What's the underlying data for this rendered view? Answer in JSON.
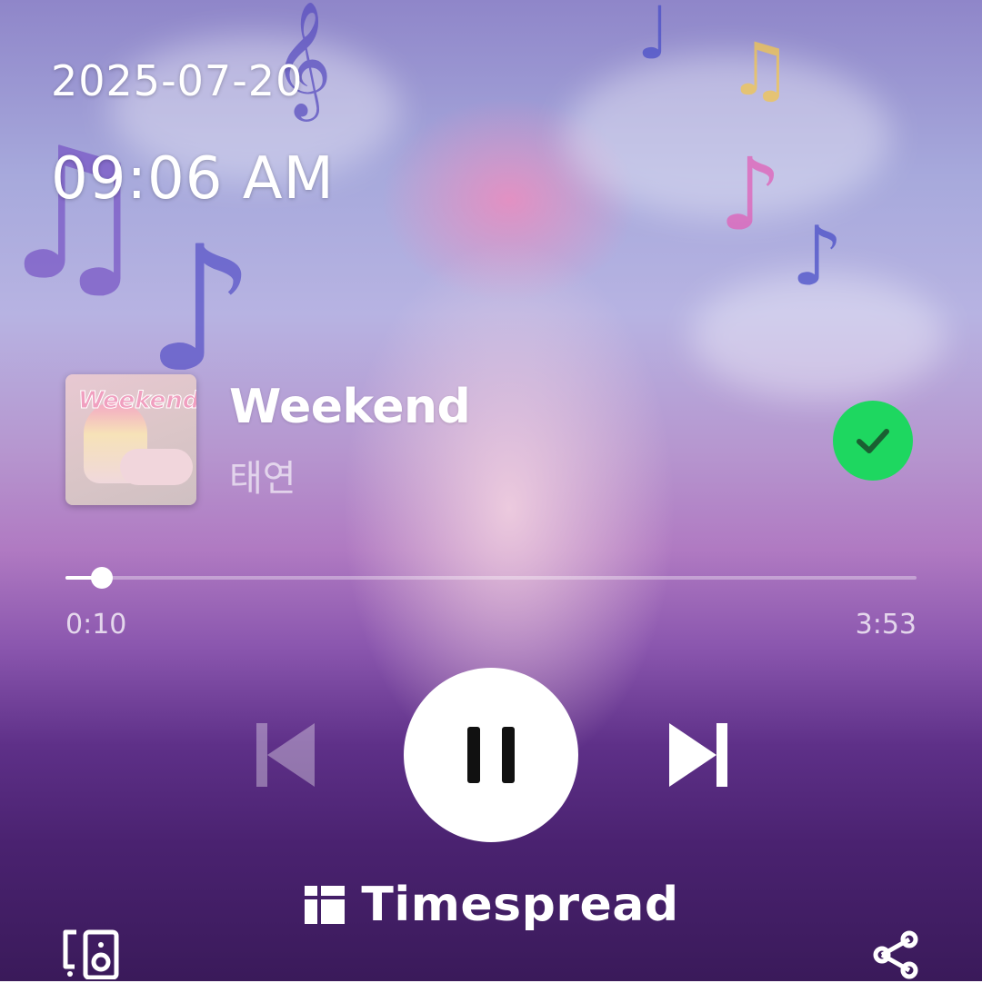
{
  "status": {
    "date": "2025-07-20",
    "time": "09:06 AM"
  },
  "now_playing": {
    "title": "Weekend",
    "artist": "태연",
    "album_art_text": "Weekend",
    "liked": true,
    "colors": {
      "liked": "#1ed760"
    }
  },
  "progress": {
    "current": "0:10",
    "total": "3:53",
    "fraction": 0.043
  },
  "controls": {
    "previous_icon": "skip-previous-icon",
    "play_pause_icon": "pause-icon",
    "next_icon": "skip-next-icon"
  },
  "footer": {
    "brand": "Timespread",
    "devices_icon": "speaker-device-icon",
    "share_icon": "share-icon"
  }
}
